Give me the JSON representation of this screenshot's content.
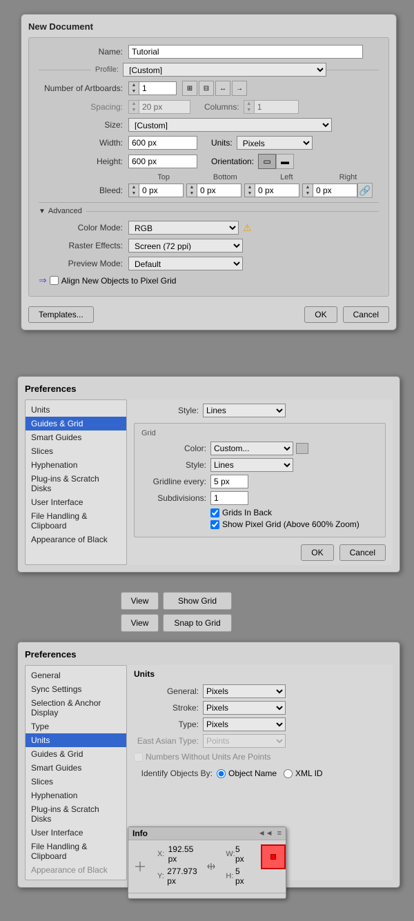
{
  "newDoc": {
    "title": "New Document",
    "name_label": "Name:",
    "name_value": "Tutorial",
    "profile_label": "Profile:",
    "profile_value": "[Custom]",
    "artboards_label": "Number of Artboards:",
    "artboards_value": "1",
    "artboard_icons": [
      "grid-2x2",
      "grid-3x2",
      "arrange",
      "arrow-right"
    ],
    "spacing_label": "Spacing:",
    "spacing_value": "20 px",
    "columns_label": "Columns:",
    "columns_value": "1",
    "size_label": "Size:",
    "size_value": "[Custom]",
    "width_label": "Width:",
    "width_value": "600 px",
    "units_label": "Units:",
    "units_value": "Pixels",
    "height_label": "Height:",
    "height_value": "600 px",
    "orientation_label": "Orientation:",
    "bleed_label": "Bleed:",
    "bleed_top_label": "Top",
    "bleed_bottom_label": "Bottom",
    "bleed_left_label": "Left",
    "bleed_right_label": "Right",
    "bleed_top_value": "0 px",
    "bleed_bottom_value": "0 px",
    "bleed_left_value": "0 px",
    "bleed_right_value": "0 px",
    "advanced_label": "Advanced",
    "color_mode_label": "Color Mode:",
    "color_mode_value": "RGB",
    "raster_label": "Raster Effects:",
    "raster_value": "Screen (72 ppi)",
    "preview_label": "Preview Mode:",
    "preview_value": "Default",
    "pixel_grid_label": "Align New Objects to Pixel Grid",
    "templates_btn": "Templates...",
    "ok_btn": "OK",
    "cancel_btn": "Cancel"
  },
  "guidesPrefs": {
    "title": "Preferences",
    "sidebar_items": [
      {
        "label": "Units",
        "active": false,
        "disabled": false
      },
      {
        "label": "Guides & Grid",
        "active": true,
        "disabled": false
      },
      {
        "label": "Smart Guides",
        "active": false,
        "disabled": false
      },
      {
        "label": "Slices",
        "active": false,
        "disabled": false
      },
      {
        "label": "Hyphenation",
        "active": false,
        "disabled": false
      },
      {
        "label": "Plug-ins & Scratch Disks",
        "active": false,
        "disabled": false
      },
      {
        "label": "User Interface",
        "active": false,
        "disabled": false
      },
      {
        "label": "File Handling & Clipboard",
        "active": false,
        "disabled": false
      },
      {
        "label": "Appearance of Black",
        "active": false,
        "disabled": false
      }
    ],
    "guides_section": {
      "style_label": "Style:",
      "style_value": "Lines"
    },
    "grid_section_title": "Grid",
    "grid_color_label": "Color:",
    "grid_color_value": "Custom...",
    "grid_style_label": "Style:",
    "grid_style_value": "Lines",
    "gridline_label": "Gridline every:",
    "gridline_value": "5 px",
    "subdivisions_label": "Subdivisions:",
    "subdivisions_value": "1",
    "grids_back_label": "Grids In Back",
    "grids_back_checked": true,
    "show_pixel_label": "Show Pixel Grid (Above 600% Zoom)",
    "show_pixel_checked": true,
    "ok_btn": "OK",
    "cancel_btn": "Cancel"
  },
  "viewButtons": {
    "view1_label": "View",
    "show_grid_label": "Show Grid",
    "view2_label": "View",
    "snap_grid_label": "Snap to Grid"
  },
  "unitsPrefs": {
    "title": "Preferences",
    "sidebar_items": [
      {
        "label": "General",
        "active": false,
        "disabled": false
      },
      {
        "label": "Sync Settings",
        "active": false,
        "disabled": false
      },
      {
        "label": "Selection & Anchor Display",
        "active": false,
        "disabled": false
      },
      {
        "label": "Type",
        "active": false,
        "disabled": false
      },
      {
        "label": "Units",
        "active": true,
        "disabled": false
      },
      {
        "label": "Guides & Grid",
        "active": false,
        "disabled": false
      },
      {
        "label": "Smart Guides",
        "active": false,
        "disabled": false
      },
      {
        "label": "Slices",
        "active": false,
        "disabled": false
      },
      {
        "label": "Hyphenation",
        "active": false,
        "disabled": false
      },
      {
        "label": "Plug-ins & Scratch Disks",
        "active": false,
        "disabled": false
      },
      {
        "label": "User Interface",
        "active": false,
        "disabled": false
      },
      {
        "label": "File Handling & Clipboard",
        "active": false,
        "disabled": false
      },
      {
        "label": "Appearance of Black",
        "active": false,
        "disabled": true
      }
    ],
    "units_section": "Units",
    "general_label": "General:",
    "general_value": "Pixels",
    "stroke_label": "Stroke:",
    "stroke_value": "Pixels",
    "type_label": "Type:",
    "type_value": "Pixels",
    "east_asian_label": "East Asian Type:",
    "east_asian_value": "Points",
    "numbers_without_units_label": "Numbers Without Units Are Points",
    "identify_label": "Identify Objects By:",
    "object_name_label": "Object Name",
    "xml_id_label": "XML ID"
  },
  "infoPanel": {
    "title": "Info",
    "x_label": "X:",
    "x_value": "192.55 px",
    "y_label": "Y:",
    "y_value": "277.973 px",
    "w_label": "W:",
    "w_value": "5 px",
    "h_label": "H:",
    "h_value": "5 px",
    "collapse_icon": "◄◄",
    "menu_icon": "≡"
  }
}
